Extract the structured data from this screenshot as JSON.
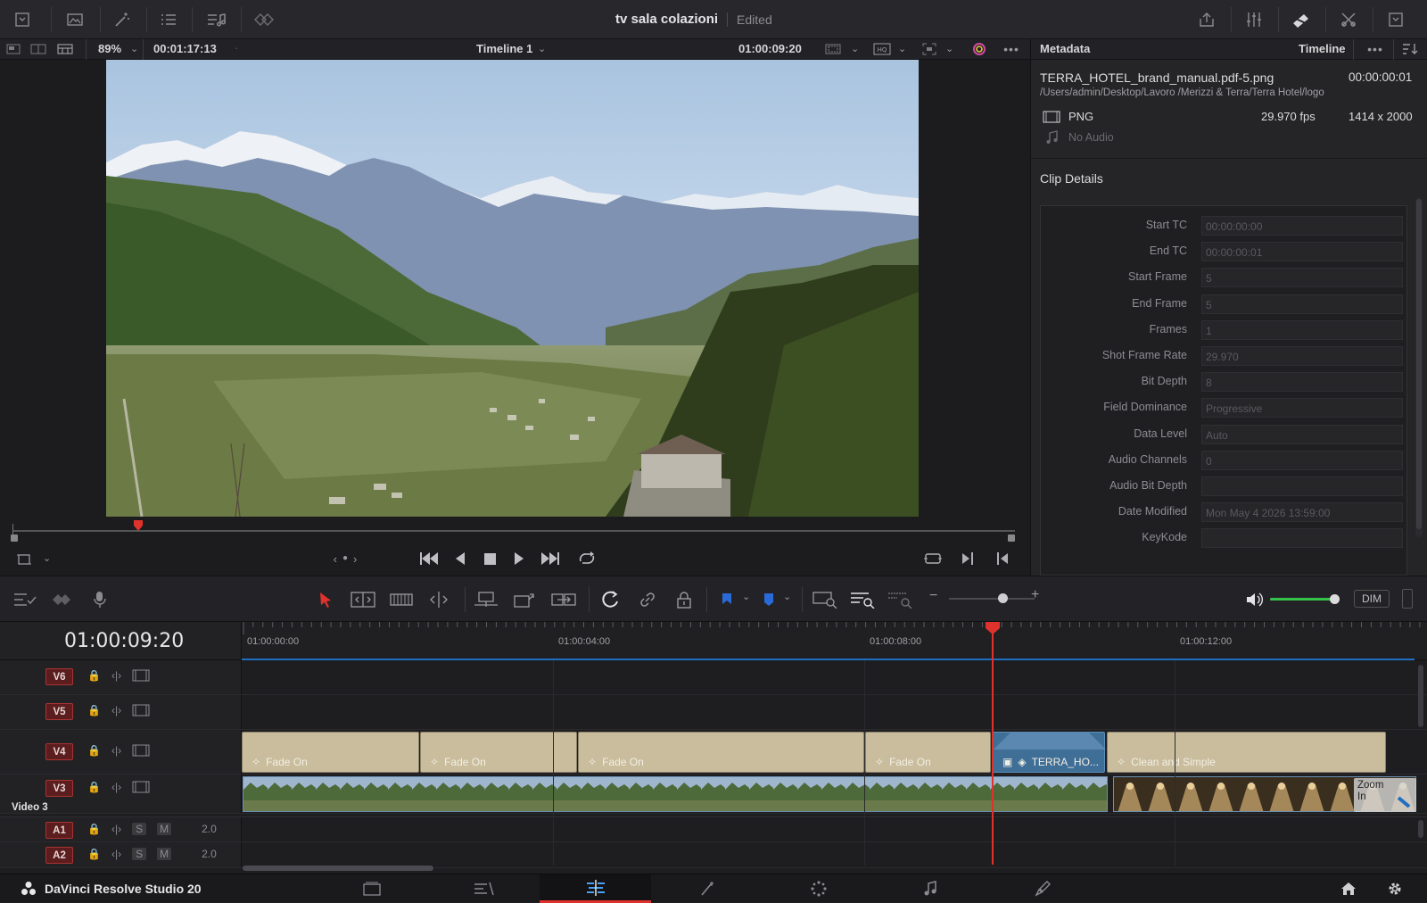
{
  "project": {
    "title": "tv sala colazioni",
    "status": "Edited"
  },
  "viewer": {
    "zoom": "89%",
    "source_tc": "00:01:17:13",
    "timeline_name": "Timeline 1",
    "record_tc": "01:00:09:20",
    "scrub_position": 0.125
  },
  "metadata": {
    "panel_title": "Metadata",
    "panel_source": "Timeline",
    "clip_name": "TERRA_HOTEL_brand_manual.pdf-5.png",
    "clip_duration": "00:00:00:01",
    "clip_path": "/Users/admin/Desktop/Lavoro /Merizzi & Terra/Terra Hotel/logo",
    "format": "PNG",
    "fps": "29.970 fps",
    "resolution": "1414 x 2000",
    "audio": "No Audio",
    "section_title": "Clip Details",
    "fields": [
      {
        "label": "Start TC",
        "value": "00:00:00:00"
      },
      {
        "label": "End TC",
        "value": "00:00:00:01"
      },
      {
        "label": "Start Frame",
        "value": "5"
      },
      {
        "label": "End Frame",
        "value": "5"
      },
      {
        "label": "Frames",
        "value": "1"
      },
      {
        "label": "Shot Frame Rate",
        "value": "29.970"
      },
      {
        "label": "Bit Depth",
        "value": "8"
      },
      {
        "label": "Field Dominance",
        "value": "Progressive"
      },
      {
        "label": "Data Level",
        "value": "Auto"
      },
      {
        "label": "Audio Channels",
        "value": "0"
      },
      {
        "label": "Audio Bit Depth",
        "value": ""
      },
      {
        "label": "Date Modified",
        "value": "Mon May 4 2026 13:59:00"
      },
      {
        "label": "KeyKode",
        "value": ""
      }
    ]
  },
  "toolbar": {
    "dim_label": "DIM",
    "zoom_level": 0.62,
    "volume_level": 0.95
  },
  "timeline": {
    "current_tc": "01:00:09:20",
    "ruler": [
      "01:00:00:00",
      "01:00:04:00",
      "01:00:08:00",
      "01:00:12:00"
    ],
    "tracks": {
      "v6": "V6",
      "v5": "V5",
      "v4": "V4",
      "v3": "V3",
      "v3_name": "Video 3",
      "a1": "A1",
      "a2": "A2",
      "solo": "S",
      "mute": "M",
      "a1_level": "2.0",
      "a2_level": "2.0"
    },
    "v4_clips": [
      "Fade On",
      "Fade On",
      "Fade On",
      "Fade On",
      "TERRA_HO...",
      "Clean and Simple"
    ],
    "v3_tail_label": "Zoom In"
  },
  "app": {
    "name": "DaVinci Resolve Studio 20"
  },
  "colors": {
    "accent_red": "#e0322c",
    "clip_fill": "#c9bd9d",
    "selected_clip": "#3f6e96",
    "playhead": "#e0322c"
  }
}
